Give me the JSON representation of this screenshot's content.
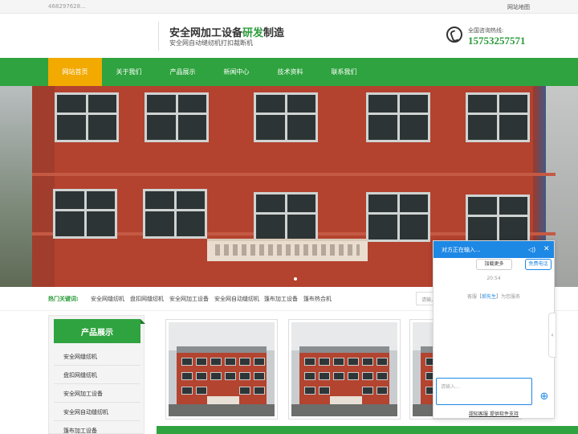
{
  "topbar": {
    "phone": "468297628...",
    "sitemap": "网站地图"
  },
  "header": {
    "title_a": "安全网加工设备",
    "title_hl": "研发",
    "title_b": "制造",
    "subtitle": "安全网自动缝纫机打扣裁断机",
    "tel_label": "全国咨询热线:",
    "tel_number": "15753257571"
  },
  "nav": {
    "items": [
      "网站首页",
      "关于我们",
      "产品展示",
      "新闻中心",
      "技术资料",
      "联系我们"
    ],
    "active": 0
  },
  "hot": {
    "label": "热门关键词:",
    "keywords": [
      "安全网缝纫机",
      "盘扣网缝纫机",
      "安全网加工设备",
      "安全网自动缝纫机",
      "篷布加工设备",
      "篷布热合机"
    ],
    "search_placeholder": "请输入"
  },
  "sidebar": {
    "title": "产品展示",
    "items": [
      "安全网缝纫机",
      "盘扣网缝纫机",
      "安全网加工设备",
      "安全网自动缝纫机",
      "篷布加工设备"
    ]
  },
  "chat": {
    "status": "对方正在输入...",
    "load_more": "加载更多",
    "free_call": "免费电话",
    "time": "20:54",
    "service_prefix": "客服【",
    "service_name": "郝先生",
    "service_suffix": "】为您服务",
    "input_placeholder": "请输入...",
    "footer": "甜知客服 提供软件支持",
    "tab_arrow": "‹"
  },
  "colors": {
    "brand_green": "#2fa33f",
    "nav_active": "#f2a900",
    "chat_blue": "#1e88e5"
  }
}
